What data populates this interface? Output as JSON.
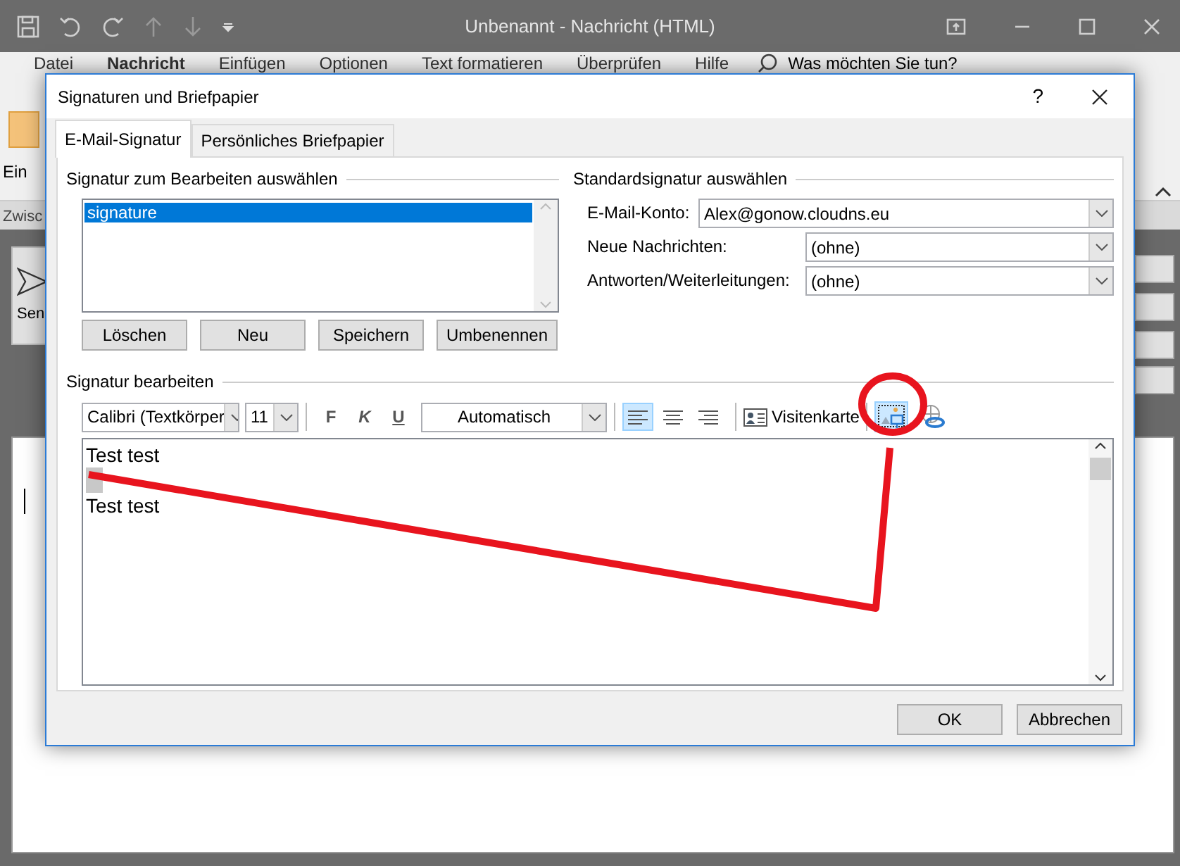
{
  "app": {
    "title": "Unbenannt  -  Nachricht (HTML)",
    "ribbon_tabs": [
      {
        "label": "Datei",
        "selected": false
      },
      {
        "label": "Nachricht",
        "selected": true
      },
      {
        "label": "Einfügen",
        "selected": false
      },
      {
        "label": "Optionen",
        "selected": false
      },
      {
        "label": "Text formatieren",
        "selected": false
      },
      {
        "label": "Überprüfen",
        "selected": false
      },
      {
        "label": "Hilfe",
        "selected": false
      }
    ],
    "tell_me": "Was möchten Sie tun?",
    "ribbon_group": "Ein",
    "clipboard_label": "Zwisc",
    "send_button": "Sen"
  },
  "dialog": {
    "title": "Signaturen und Briefpapier",
    "help": "?",
    "tabs": [
      {
        "label": "E-Mail-Signatur",
        "selected": true
      },
      {
        "label": "Persönliches Briefpapier",
        "selected": false
      }
    ],
    "select_signature": {
      "heading": "Signatur zum Bearbeiten auswählen",
      "items": [
        {
          "label": "signature",
          "selected": true
        }
      ],
      "buttons": [
        "Löschen",
        "Neu",
        "Speichern",
        "Umbenennen"
      ]
    },
    "default_signature": {
      "heading": "Standardsignatur auswählen",
      "fields": [
        {
          "label": "E-Mail-Konto:",
          "value": "Alex@gonow.cloudns.eu",
          "kind": "wide"
        },
        {
          "label": "Neue Nachrichten:",
          "value": "(ohne)",
          "kind": "narrow"
        },
        {
          "label": "Antworten/Weiterleitungen:",
          "value": "(ohne)",
          "kind": "narrow"
        }
      ]
    },
    "edit": {
      "heading": "Signatur bearbeiten",
      "font": "Calibri (Textkörper",
      "size": "11",
      "bold": "F",
      "italic": "K",
      "underline": "U",
      "text_color_choice": "Automatisch",
      "align": [
        {
          "kind": "left",
          "selected": true
        },
        {
          "kind": "center",
          "selected": false
        },
        {
          "kind": "right",
          "selected": false
        }
      ],
      "business_card": "Visitenkarte",
      "picture_selected": true,
      "body": [
        {
          "kind": "text",
          "text": "Test test"
        },
        {
          "kind": "blank"
        },
        {
          "kind": "text",
          "text": "Test test"
        }
      ]
    },
    "buttons": [
      "OK",
      "Abbrechen"
    ]
  }
}
